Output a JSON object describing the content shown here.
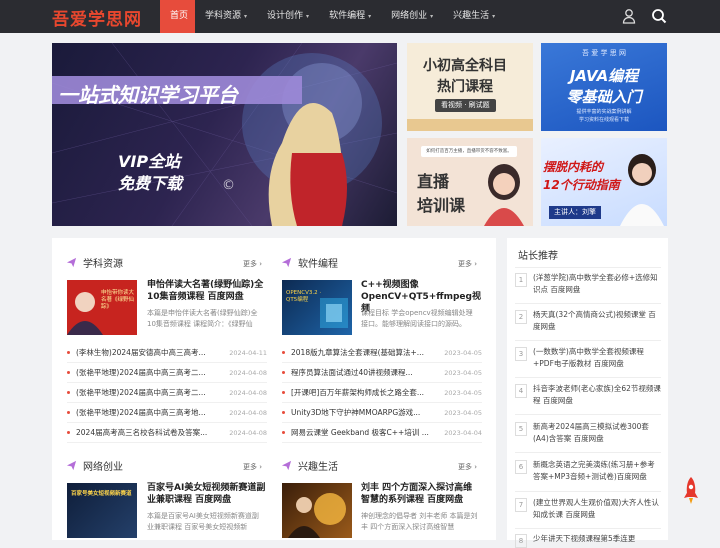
{
  "header": {
    "logo": "吾爱学思网",
    "nav": [
      {
        "label": "首页",
        "active": true,
        "dropdown": false
      },
      {
        "label": "学科资源",
        "active": false,
        "dropdown": true
      },
      {
        "label": "设计创作",
        "active": false,
        "dropdown": true
      },
      {
        "label": "软件编程",
        "active": false,
        "dropdown": true
      },
      {
        "label": "网络创业",
        "active": false,
        "dropdown": true
      },
      {
        "label": "兴趣生活",
        "active": false,
        "dropdown": true
      }
    ],
    "caret": "▾"
  },
  "banner": {
    "headline": "一站式知识学习平台",
    "sub1": "VIP全站",
    "sub2": "免费下载",
    "mark": "©"
  },
  "tiles": {
    "t1": {
      "line1": "小初高全科目",
      "line2": "热门课程",
      "tag": "看视频 · 刷试题"
    },
    "t2": {
      "top": "吾 爱 学 思 网",
      "line1": "JAVA编程",
      "line2": "零基础入门",
      "small1": "提供丰富的实战案例讲解",
      "small2": "学习资料在线观看下载"
    },
    "t3": {
      "top": "如何打造百万主播，直播带货不容不致富。",
      "line1": "直播",
      "line2": "培训课"
    },
    "t4": {
      "line1": "摆脱内耗的",
      "line2": "12个行动指南",
      "tag": "主讲人：刘擎"
    }
  },
  "sections": {
    "s1": {
      "title": "学科资源",
      "more": "更多",
      "feat_title": "申怡伴读大名著(绿野仙踪)全10集音频课程 百度网盘",
      "feat_desc": "本篇是申怡伴读大名著(绿野仙踪)全10集音频课程 课程简介：《绿野仙",
      "thumb_text": "申怡带你读大名著《绿野仙踪》",
      "items": [
        {
          "t": "(李林生物)2024届安德高中高三高考...",
          "d": "2024-04-11"
        },
        {
          "t": "(张艳平地理)2024届高中高三高考二...",
          "d": "2024-04-08"
        },
        {
          "t": "(张艳平地理)2024届高中高三高考二...",
          "d": "2024-04-08"
        },
        {
          "t": "(张艳平地理)2024届高中高三高考地...",
          "d": "2024-04-08"
        },
        {
          "t": "2024届高考高三名校各科试卷及答案...",
          "d": "2024-04-08"
        }
      ]
    },
    "s2": {
      "title": "软件编程",
      "more": "更多",
      "feat_title": "C++视频图像OpenCV+QT5+ffmpeg视频",
      "feat_desc": "课程目标 学会opencv视频编辑处理接口。能够理解阅读接口的源码。",
      "thumb_text": "OPENCV3.2 · QT5编程",
      "items": [
        {
          "t": "2018版九章算法全套课程(基础算法+...",
          "d": "2023-04-05"
        },
        {
          "t": "程序员算法面试通过40讲视频课程...",
          "d": "2023-04-05"
        },
        {
          "t": "[开课吧]百万年薪架构师成长之路全套...",
          "d": "2023-04-05"
        },
        {
          "t": "Unity3D地下守护神MMOARPG游戏...",
          "d": "2023-04-05"
        },
        {
          "t": "网易云课堂 Geekband 极客C++培训 ...",
          "d": "2023-04-04"
        }
      ]
    },
    "s3": {
      "title": "网络创业",
      "more": "更多",
      "feat_title": "百家号AI美女短视频新赛道副业兼职课程 百度网盘",
      "feat_desc": "本篇是百家号AI美女短视频新赛道副业兼职课程 百家号美女短视频新",
      "thumb_text": "百家号美女短视频新赛道"
    },
    "s4": {
      "title": "兴趣生活",
      "more": "更多",
      "feat_title": "刘丰 四个方面深入探讨高维智慧的系列课程 百度网盘",
      "feat_desc": "神创理念的倡导者 刘丰老师 本篇是刘丰 四个方面深入探讨高维智慧"
    }
  },
  "sidebar": {
    "title": "站长推荐",
    "items": [
      {
        "n": "1",
        "t": "(洋葱学院)高中数学全套必修+选修知识点 百度网盘"
      },
      {
        "n": "2",
        "t": "杨天真(32个高情商公式)视频课堂 百度网盘"
      },
      {
        "n": "3",
        "t": "(一数数学)高中数学全套视频课程+PDF电子版教材 百度网盘"
      },
      {
        "n": "4",
        "t": "抖音李波老师(老心家族)全62节视频课程 百度网盘"
      },
      {
        "n": "5",
        "t": "新高考2024届高三模拟试卷300套(A4)含答案 百度网盘"
      },
      {
        "n": "6",
        "t": "新概念英语之完美演练(练习册+参考答案+MP3音频+测试卷)百度网盘"
      },
      {
        "n": "7",
        "t": "(建立世界观人生观价值观)大齐人性认知成长课 百度网盘"
      },
      {
        "n": "8",
        "t": "少年讲天下视频课程第5季连更"
      }
    ]
  }
}
